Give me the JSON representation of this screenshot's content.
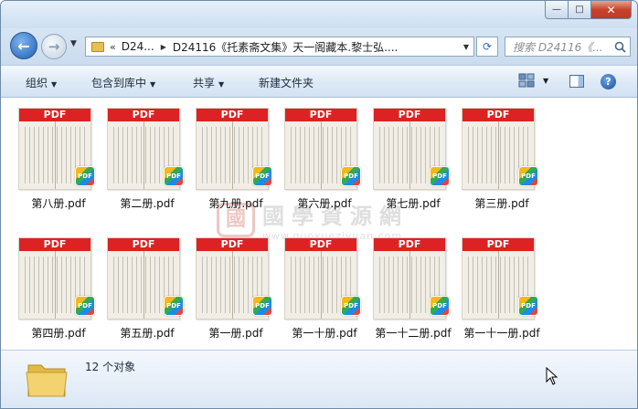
{
  "window": {
    "controls": {
      "minimize": "—",
      "maximize": "□",
      "close": "✕"
    }
  },
  "address": {
    "chevron": "«",
    "seg1": "D24...",
    "path": "D24116《托素斋文集》天一阁藏本.黎士弘....",
    "search_placeholder": "搜索 D24116《...",
    "icons": [
      "back-icon",
      "forward-icon",
      "folder-icon",
      "refresh-icon",
      "search-icon"
    ]
  },
  "toolbar": {
    "organize": "组织",
    "include": "包含到库中",
    "share": "共享",
    "new_folder": "新建文件夹"
  },
  "files": [
    {
      "name": "第八册.pdf"
    },
    {
      "name": "第二册.pdf"
    },
    {
      "name": "第九册.pdf"
    },
    {
      "name": "第六册.pdf"
    },
    {
      "name": "第七册.pdf"
    },
    {
      "name": "第三册.pdf"
    },
    {
      "name": "第四册.pdf"
    },
    {
      "name": "第五册.pdf"
    },
    {
      "name": "第一册.pdf"
    },
    {
      "name": "第一十册.pdf"
    },
    {
      "name": "第一十二册.pdf"
    },
    {
      "name": "第一十一册.pdf"
    }
  ],
  "thumb_label": "PDF",
  "watermark": {
    "seal": "國",
    "title": "國學資源網",
    "url": "www.guoxueziyuan.com"
  },
  "status": {
    "count": "12 个对象"
  },
  "colors": {
    "pdf_band": "#dc2222",
    "titlebar": "#cddff0",
    "accent": "#1e5fb4"
  }
}
